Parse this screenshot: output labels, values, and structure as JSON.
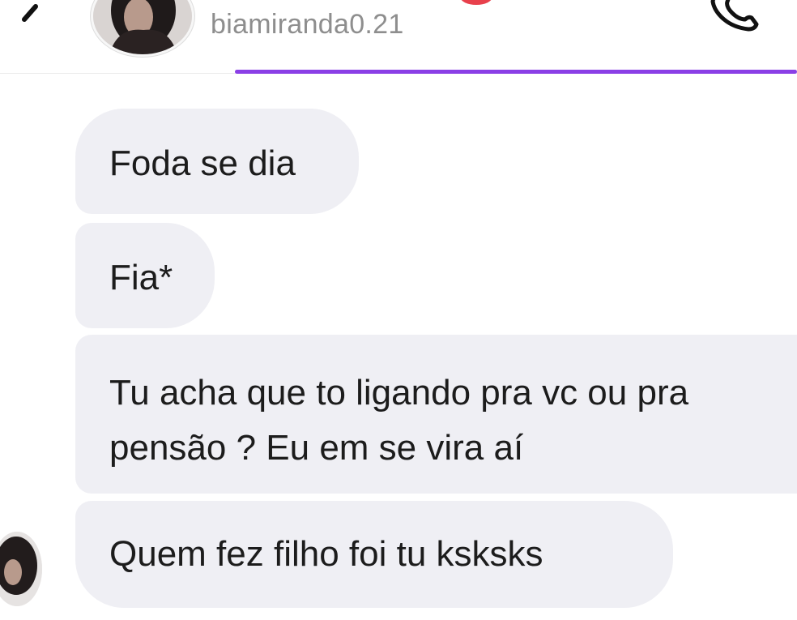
{
  "header": {
    "username": "biamiranda0.21",
    "back_icon": "chevron-left-icon",
    "call_icon": "phone-icon",
    "accent_color": "#8a3fe6"
  },
  "messages": [
    {
      "text": "Foda se dia"
    },
    {
      "text": "Fia*"
    },
    {
      "line1": "Tu acha que to ligando pra vc ou pra",
      "line2": "pensão ? Eu em se vira aí"
    },
    {
      "text": "Quem fez filho foi tu ksksks"
    }
  ]
}
